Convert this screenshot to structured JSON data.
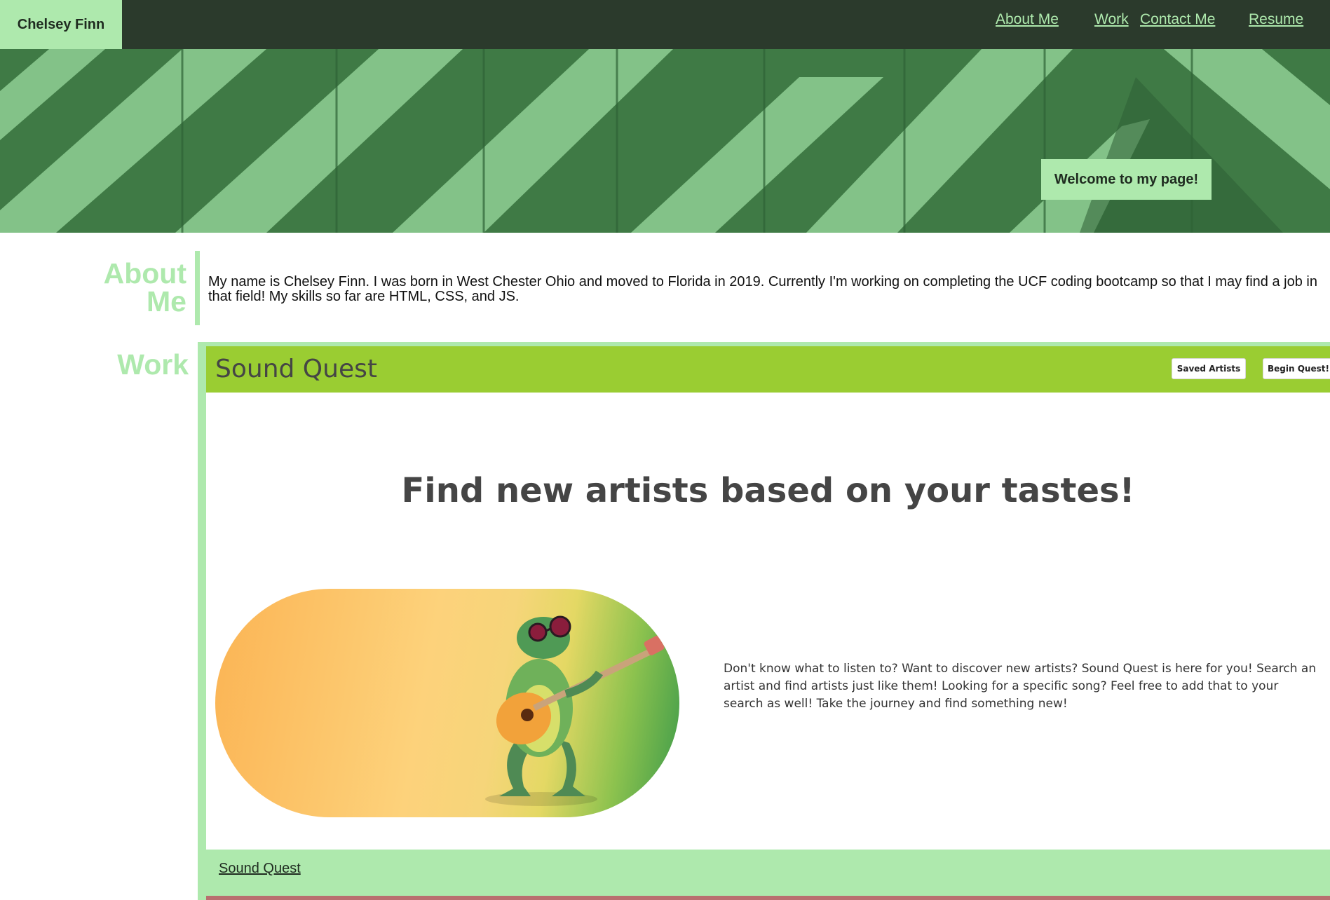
{
  "header": {
    "brand": "Chelsey Finn",
    "nav": [
      {
        "label": "About Me"
      },
      {
        "label": "Work"
      },
      {
        "label": "Contact Me"
      },
      {
        "label": "Resume"
      }
    ]
  },
  "hero": {
    "welcome_label": "Welcome to my page!"
  },
  "about": {
    "title": "About Me",
    "text": "My name is Chelsey Finn. I was born in West Chester Ohio and moved to Florida in 2019. Currently I'm working on completing the UCF coding bootcamp so that I may find a job in that field! My skills so far are HTML, CSS, and JS."
  },
  "work": {
    "title": "Work",
    "projects": [
      {
        "app_title": "Sound Quest",
        "saved_label": "Saved Artists",
        "begin_label": "Begin Quest!",
        "headline": "Find new artists based on your tastes!",
        "description": "Don't know what to listen to? Want to discover new artists? Sound Quest is here for you! Search an artist and find artists just like them! Looking for a specific song? Feel free to add that to your search as well! Take the journey and find something new!",
        "link_label": "Sound Quest"
      }
    ]
  },
  "colors": {
    "header_bg": "#2b3a2c",
    "accent": "#aee9ad",
    "hero_green": "#4a8a4f",
    "sound_quest_bar": "#9acd32"
  }
}
